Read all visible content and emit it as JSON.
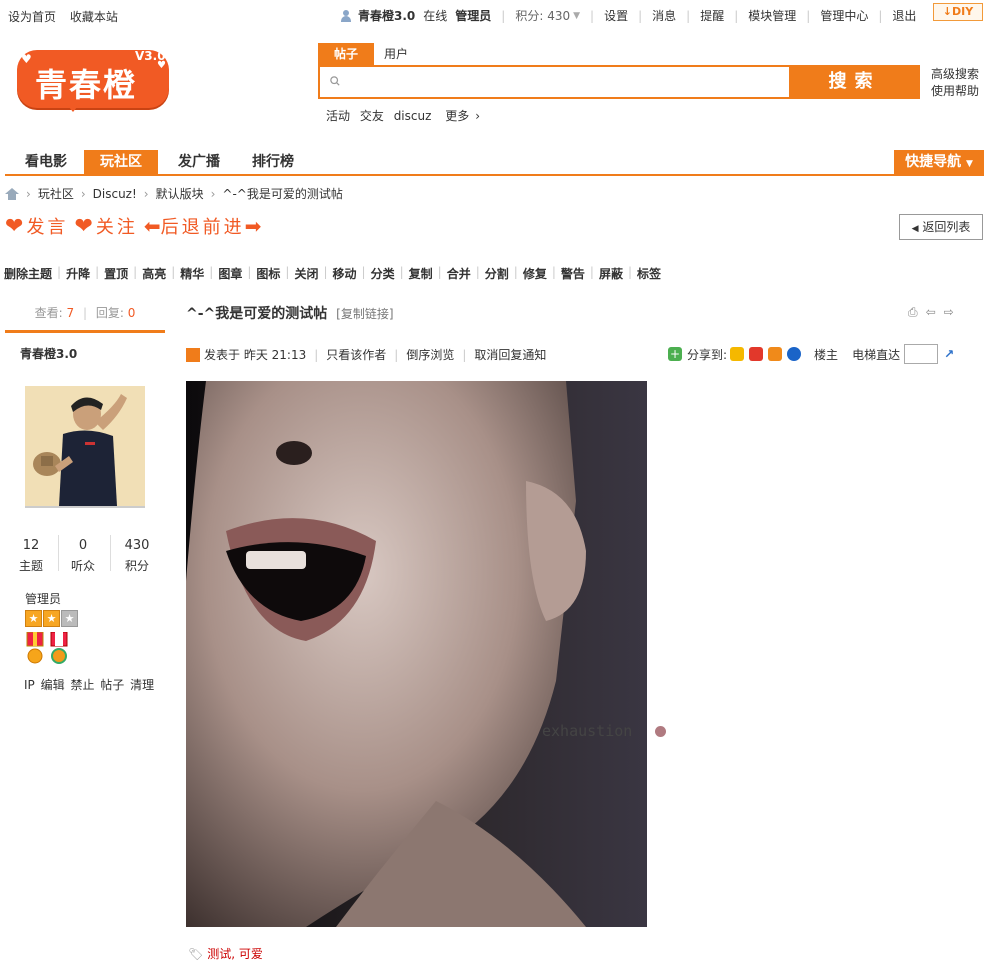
{
  "topbar": {
    "set_home": "设为首页",
    "bookmark": "收藏本站",
    "username": "青春橙3.0",
    "online": "在线",
    "role": "管理员",
    "points": "积分: 430",
    "links": [
      "设置",
      "消息",
      "提醒",
      "模块管理",
      "管理中心",
      "退出"
    ],
    "diy": "DIY"
  },
  "logo": {
    "text": "青春橙",
    "version": "V3.0"
  },
  "search": {
    "tab_active": "帖子",
    "tab_other": "用户",
    "placeholder": "",
    "button": "搜索",
    "advanced": "高级搜索",
    "help": "使用帮助",
    "hot_words": [
      "活动",
      "交友",
      "discuz",
      "更多"
    ]
  },
  "nav": {
    "items": [
      "看电影",
      "玩社区",
      "发广播",
      "排行榜"
    ],
    "active_index": 1,
    "quicknav": "快捷导航"
  },
  "breadcrumb": [
    "玩社区",
    "Discuz!",
    "默认版块",
    "^-^我是可爱的测试帖"
  ],
  "actions": {
    "post": "发言",
    "follow": "关注",
    "prev": "后退",
    "next": "前进",
    "back_list": "返回列表"
  },
  "moderation": [
    "删除主题",
    "升降",
    "置顶",
    "高亮",
    "精华",
    "图章",
    "图标",
    "关闭",
    "移动",
    "分类",
    "复制",
    "合并",
    "分割",
    "修复",
    "警告",
    "屏蔽",
    "标签"
  ],
  "thread_stats": {
    "views_label": "查看:",
    "views": "7",
    "replies_label": "回复:",
    "replies": "0"
  },
  "author": {
    "name": "青春橙3.0",
    "threads": "12",
    "threads_label": "主题",
    "followers": "0",
    "followers_label": "听众",
    "points": "430",
    "points_label": "积分",
    "group": "管理员",
    "admin_links": [
      "IP",
      "编辑",
      "禁止",
      "帖子",
      "清理"
    ]
  },
  "post": {
    "title": "^-^我是可爱的测试帖",
    "copy_link": "[复制链接]",
    "posted_at": "发表于 昨天 21:13",
    "only_author": "只看该作者",
    "reverse": "倒序浏览",
    "cancel_notify": "取消回复通知",
    "share_label": "分享到:",
    "floor_label": "楼主",
    "jump_label": "电梯直达",
    "image_caption": "exhaustion",
    "tags": "测试, 可爱"
  },
  "colors": {
    "accent": "#f07c1a",
    "brand": "#f15a24"
  }
}
